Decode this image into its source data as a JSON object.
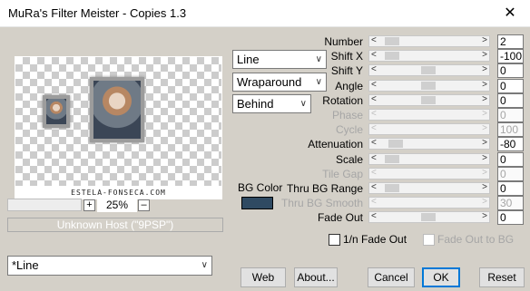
{
  "window": {
    "title": "MuRa's Filter Meister - Copies 1.3",
    "close_glyph": "✕"
  },
  "preview": {
    "watermark": "ESTELA-FONSECA.COM",
    "zoom": "25%",
    "zoom_plus": "+",
    "zoom_minus": "–",
    "host_text": "Unknown Host (\"9PSP\")"
  },
  "dropdowns": {
    "mode": "Line",
    "edge": "Wraparound",
    "placement": "Behind",
    "preset": "*Line"
  },
  "bg_color": {
    "label": "BG Color",
    "value": "#2f4a62"
  },
  "params": [
    {
      "label": "Number",
      "value": "2",
      "enabled": true,
      "thumb": 0.06
    },
    {
      "label": "Shift X",
      "value": "-100",
      "enabled": true,
      "thumb": 0.06
    },
    {
      "label": "Shift Y",
      "value": "0",
      "enabled": true,
      "thumb": 0.5
    },
    {
      "label": "Angle",
      "value": "0",
      "enabled": true,
      "thumb": 0.5
    },
    {
      "label": "Rotation",
      "value": "0",
      "enabled": true,
      "thumb": 0.5
    },
    {
      "label": "Phase",
      "value": "0",
      "enabled": false,
      "thumb": 0.0
    },
    {
      "label": "Cycle",
      "value": "100",
      "enabled": false,
      "thumb": 0.0
    },
    {
      "label": "Attenuation",
      "value": "-80",
      "enabled": true,
      "thumb": 0.1
    },
    {
      "label": "Scale",
      "value": "0",
      "enabled": true,
      "thumb": 0.06
    },
    {
      "label": "Tile Gap",
      "value": "0",
      "enabled": false,
      "thumb": 0.0
    },
    {
      "label": "Thru BG Range",
      "value": "0",
      "enabled": true,
      "thumb": 0.06
    },
    {
      "label": "Thru BG Smooth",
      "value": "30",
      "enabled": false,
      "thumb": 0.0
    },
    {
      "label": "Fade Out",
      "value": "0",
      "enabled": true,
      "thumb": 0.5
    }
  ],
  "checks": {
    "fade_n": "1/n Fade Out",
    "fade_bg": "Fade Out to BG"
  },
  "buttons": {
    "web": "Web",
    "about": "About...",
    "cancel": "Cancel",
    "ok": "OK",
    "reset": "Reset"
  },
  "arrows": {
    "left": "<",
    "right": ">",
    "down": "▽"
  }
}
